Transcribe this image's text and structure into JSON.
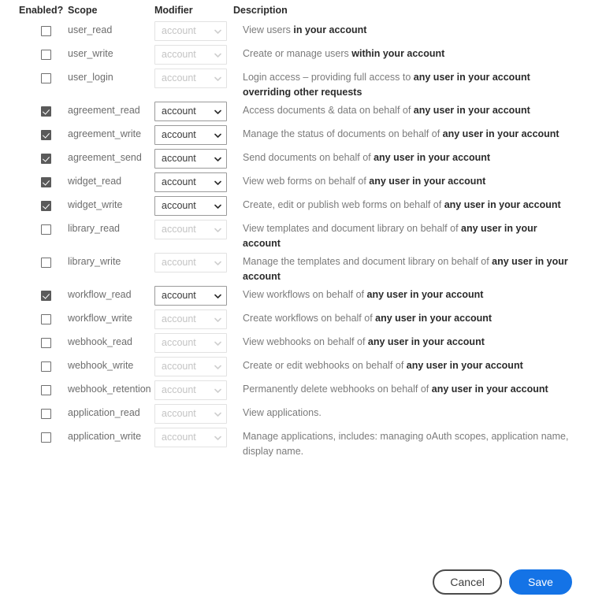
{
  "table": {
    "headers": {
      "enabled": "Enabled?",
      "scope": "Scope",
      "modifier": "Modifier",
      "description": "Description"
    },
    "modifier_value": "account",
    "rows": [
      {
        "scope": "user_read",
        "enabled": false,
        "modifier": "account",
        "modifier_disabled": true,
        "desc_plain": "View users ",
        "desc_bold": "in your account"
      },
      {
        "scope": "user_write",
        "enabled": false,
        "modifier": "account",
        "modifier_disabled": true,
        "desc_plain": "Create or manage users ",
        "desc_bold": "within your account"
      },
      {
        "scope": "user_login",
        "enabled": false,
        "modifier": "account",
        "modifier_disabled": true,
        "desc_plain": "Login access – providing full access to ",
        "desc_bold": "any user in your account overriding other requests"
      },
      {
        "scope": "agreement_read",
        "enabled": true,
        "modifier": "account",
        "modifier_disabled": false,
        "desc_plain": "Access documents & data on behalf of ",
        "desc_bold": "any user in your account"
      },
      {
        "scope": "agreement_write",
        "enabled": true,
        "modifier": "account",
        "modifier_disabled": false,
        "desc_plain": "Manage the status of documents on behalf of ",
        "desc_bold": "any user in your account"
      },
      {
        "scope": "agreement_send",
        "enabled": true,
        "modifier": "account",
        "modifier_disabled": false,
        "desc_plain": "Send documents on behalf of ",
        "desc_bold": "any user in your account"
      },
      {
        "scope": "widget_read",
        "enabled": true,
        "modifier": "account",
        "modifier_disabled": false,
        "desc_plain": "View web forms on behalf of ",
        "desc_bold": "any user in your account"
      },
      {
        "scope": "widget_write",
        "enabled": true,
        "modifier": "account",
        "modifier_disabled": false,
        "desc_plain": "Create, edit or publish web forms on behalf of ",
        "desc_bold": "any user in your account"
      },
      {
        "scope": "library_read",
        "enabled": false,
        "modifier": "account",
        "modifier_disabled": true,
        "desc_plain": "View templates and document library on behalf of ",
        "desc_bold": "any user in your account"
      },
      {
        "scope": "library_write",
        "enabled": false,
        "modifier": "account",
        "modifier_disabled": true,
        "desc_plain": "Manage the templates and document library on behalf of ",
        "desc_bold": "any user in your account"
      },
      {
        "scope": "workflow_read",
        "enabled": true,
        "modifier": "account",
        "modifier_disabled": false,
        "desc_plain": "View workflows on behalf of ",
        "desc_bold": "any user in your account"
      },
      {
        "scope": "workflow_write",
        "enabled": false,
        "modifier": "account",
        "modifier_disabled": true,
        "desc_plain": "Create workflows on behalf of ",
        "desc_bold": "any user in your account"
      },
      {
        "scope": "webhook_read",
        "enabled": false,
        "modifier": "account",
        "modifier_disabled": true,
        "desc_plain": "View webhooks on behalf of ",
        "desc_bold": "any user in your account"
      },
      {
        "scope": "webhook_write",
        "enabled": false,
        "modifier": "account",
        "modifier_disabled": true,
        "desc_plain": "Create or edit webhooks on behalf of ",
        "desc_bold": "any user in your account"
      },
      {
        "scope": "webhook_retention",
        "enabled": false,
        "modifier": "account",
        "modifier_disabled": true,
        "desc_plain": "Permanently delete webhooks on behalf of ",
        "desc_bold": "any user in your account"
      },
      {
        "scope": "application_read",
        "enabled": false,
        "modifier": "account",
        "modifier_disabled": true,
        "desc_plain": "View applications.",
        "desc_bold": ""
      },
      {
        "scope": "application_write",
        "enabled": false,
        "modifier": "account",
        "modifier_disabled": true,
        "desc_plain": "Manage applications, includes: managing oAuth scopes, application name, display name.",
        "desc_bold": ""
      }
    ]
  },
  "footer": {
    "cancel_label": "Cancel",
    "save_label": "Save"
  },
  "colors": {
    "accent": "#1473e6",
    "checkbox_checked": "#5a5a5a",
    "text_bold": "#2b2b2b",
    "text_muted": "#7b7b7b"
  }
}
